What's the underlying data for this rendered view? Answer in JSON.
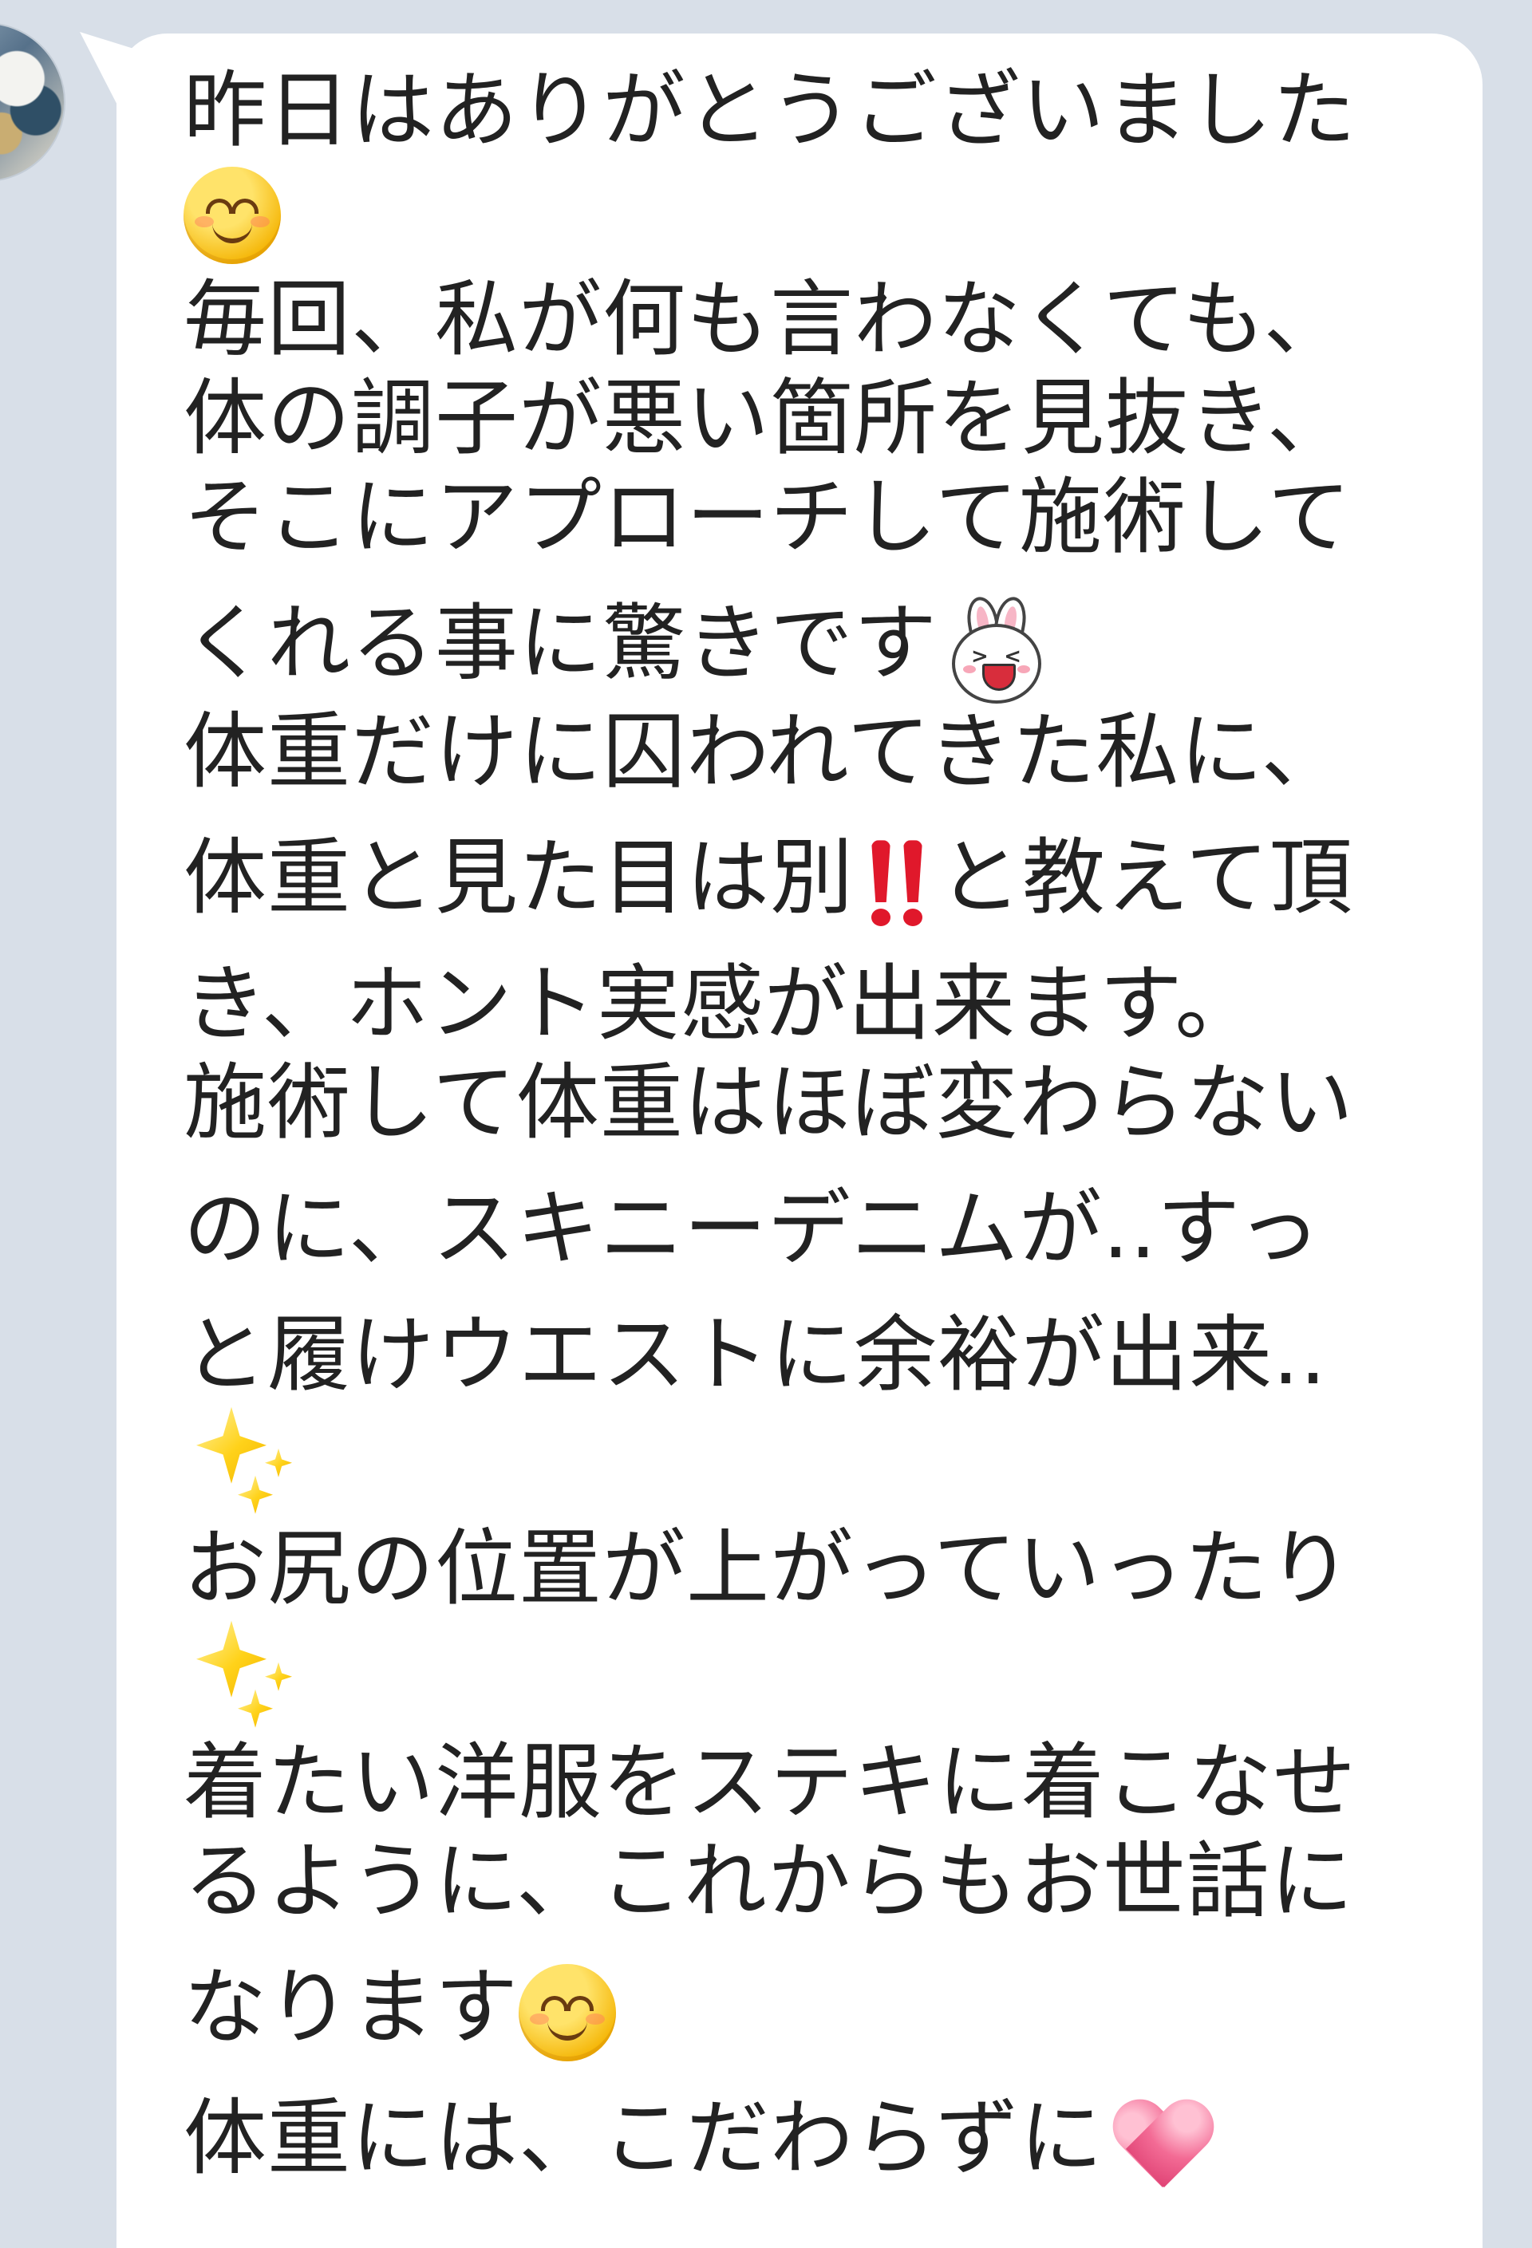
{
  "chat": {
    "sender_avatar_icon": "user-avatar",
    "bubble_color": "#ffffff",
    "background_color": "#d8dfe8",
    "message_lines": [
      "昨日はありがとうございました",
      "毎回、私が何も言わなくても、",
      "体の調子が悪い箇所を見抜き、",
      "そこにアプローチして施術して",
      "くれる事に驚きです",
      "体重だけに囚われてきた私に、",
      "体重と見た目は別",
      "と教えて頂",
      "き、ホント実感が出来ます。",
      "施術して体重はほぼ変わらない",
      "のに、スキニーデニムが..すっ",
      "と履けウエストに余裕が出来..",
      "お尻の位置が上がっていったり",
      "着たい洋服をステキに着こなせ",
      "るように、これからもお世話に",
      "なります",
      "体重には、こだわらずに"
    ],
    "emoji_icons": {
      "smile": "smiling-face-icon",
      "bunny": "laughing-bunny-sticker-icon",
      "exclamation": "double-exclamation-icon",
      "sparkles": "sparkles-icon",
      "heart": "pink-heart-icon"
    }
  }
}
